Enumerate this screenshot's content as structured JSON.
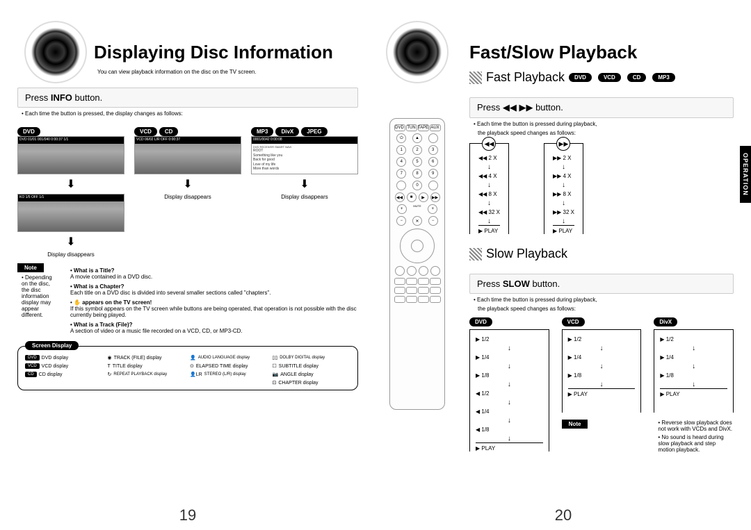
{
  "left": {
    "title": "Displaying Disc Information",
    "subtitle": "You can view playback information on the disc on the TV screen.",
    "press_box": {
      "pre": "Press ",
      "bold": "INFO",
      "post": " button."
    },
    "press_note": "• Each time the button is pressed, the display changes as follows:",
    "row_tags": {
      "col1": "DVD",
      "col2a": "VCD",
      "col2b": "CD",
      "col3a": "MP3",
      "col3b": "DivX",
      "col3c": "JPEG"
    },
    "thumb_bar1": "DVD 01/01 001/040 0:00:37 1/1",
    "thumb_bar2": "VCD 06/02 L/R OFF 0:00:37",
    "thumb_bar3": "0001/0042 0:00:08",
    "thumb3_header": "DVD RECEIVER           SMART NAVI",
    "thumb3_lines": [
      "ROOT",
      "Something like you",
      "Back for good",
      "Love of my life",
      "More than words"
    ],
    "display_disappears": "Display disappears",
    "note_label": "Note",
    "note_text": "• Depending on the disc, the disc information display may appear different.",
    "defs": {
      "title_q": "• What is a Title?",
      "title_a": "A movie contained in a DVD disc.",
      "chapter_q": "• What is a Chapter?",
      "chapter_a": "Each title on a DVD disc is divided into several smaller sections called \"chapters\".",
      "screen_q": "appears on the TV screen!",
      "screen_a": "If this symbol appears on the TV screen while buttons are being operated, that operation is not possible with the disc currently being played.",
      "track_q": "• What is a Track (File)?",
      "track_a": "A section of video or a music file recorded on a VCD, CD, or MP3-CD."
    },
    "screen_display": {
      "title": "Screen Display",
      "items": [
        "DVD display",
        "TRACK (FILE) display",
        "AUDIO LANGUAGE display",
        "DOLBY DIGITAL display",
        "VCD display",
        "TITLE display",
        "ELAPSED TIME display",
        "SUBTITLE display",
        "CD display",
        "REPEAT PLAYBACK display",
        "STEREO (L/R) display",
        "ANGLE display",
        "CHAPTER display"
      ],
      "tags": [
        "DVD",
        "VCD",
        "CD"
      ]
    },
    "page_num": "19"
  },
  "right": {
    "title": "Fast/Slow Playback",
    "op_tab": "OPERATION",
    "fast": {
      "heading": "Fast Playback",
      "tags": [
        "DVD",
        "VCD",
        "CD",
        "MP3"
      ],
      "press_pre": "Press ",
      "press_post": " button.",
      "note1": "• Each time the button is pressed during playback,",
      "note2": "the playback speed changes as follows:",
      "rew": [
        "◀◀ 2 X",
        "◀◀ 4 X",
        "◀◀ 8 X",
        "◀◀ 32 X"
      ],
      "fwd": [
        "▶▶ 2 X",
        "▶▶ 4 X",
        "▶▶ 8 X",
        "▶▶ 32 X"
      ],
      "play": "▶  PLAY"
    },
    "slow": {
      "heading": "Slow Playback",
      "press_pre": "Press  ",
      "press_bold": "SLOW",
      "press_post": " button.",
      "note1": "• Each time the button is pressed during playback,",
      "note2": "the playback speed changes as follows:",
      "cols": [
        {
          "tag": "DVD",
          "items": [
            "▶ 1/2",
            "▶ 1/4",
            "▶ 1/8",
            "◀ 1/2",
            "◀ 1/4",
            "◀ 1/8"
          ],
          "play": "▶  PLAY"
        },
        {
          "tag": "VCD",
          "items": [
            "▶ 1/2",
            "▶ 1/4",
            "▶ 1/8"
          ],
          "play": "▶  PLAY"
        },
        {
          "tag": "DivX",
          "items": [
            "▶ 1/2",
            "▶ 1/4",
            "▶ 1/8"
          ],
          "play": "▶  PLAY"
        }
      ],
      "note_label": "Note",
      "note_b1": "• Reverse slow playback does not work with VCDs and DivX.",
      "note_b2": "• No sound is heard during slow playback and step motion playback."
    },
    "page_num": "20"
  }
}
